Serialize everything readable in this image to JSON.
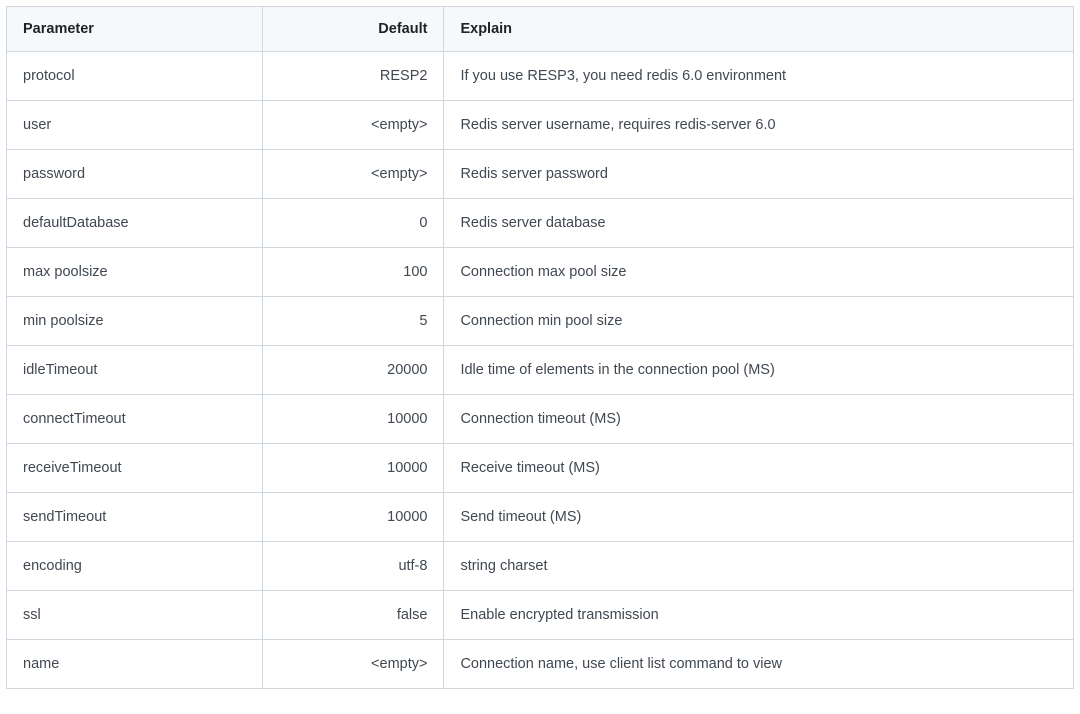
{
  "table": {
    "headers": {
      "parameter": "Parameter",
      "default": "Default",
      "explain": "Explain"
    },
    "rows": [
      {
        "parameter": "protocol",
        "default": "RESP2",
        "explain": "If you use RESP3, you need redis 6.0 environment"
      },
      {
        "parameter": "user",
        "default": "<empty>",
        "explain": "Redis server username, requires redis-server 6.0"
      },
      {
        "parameter": "password",
        "default": "<empty>",
        "explain": "Redis server password"
      },
      {
        "parameter": "defaultDatabase",
        "default": "0",
        "explain": "Redis server database"
      },
      {
        "parameter": "max poolsize",
        "default": "100",
        "explain": "Connection max pool size"
      },
      {
        "parameter": "min poolsize",
        "default": "5",
        "explain": "Connection min pool size"
      },
      {
        "parameter": "idleTimeout",
        "default": "20000",
        "explain": "Idle time of elements in the connection pool (MS)"
      },
      {
        "parameter": "connectTimeout",
        "default": "10000",
        "explain": "Connection timeout (MS)"
      },
      {
        "parameter": "receiveTimeout",
        "default": "10000",
        "explain": "Receive timeout (MS)"
      },
      {
        "parameter": "sendTimeout",
        "default": "10000",
        "explain": "Send timeout (MS)"
      },
      {
        "parameter": "encoding",
        "default": "utf-8",
        "explain": "string charset"
      },
      {
        "parameter": "ssl",
        "default": "false",
        "explain": "Enable encrypted transmission"
      },
      {
        "parameter": "name",
        "default": "<empty>",
        "explain": "Connection name, use client list command to view"
      }
    ]
  }
}
